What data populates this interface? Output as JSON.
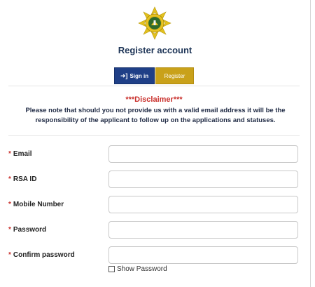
{
  "header": {
    "logo_icon": "coat-of-arms-badge-icon",
    "title": "Register account"
  },
  "tabs": [
    {
      "label": "Sign in",
      "icon": "sign-in-arrow-icon",
      "color": "#1f3f87"
    },
    {
      "label": "Register",
      "color": "#c9a11a",
      "active": true
    }
  ],
  "disclaimer": {
    "title": "***Disclaimer***",
    "text": "Please note that should you not provide us with a valid email address it will be the responsibility of the applicant to follow up on the applications and statuses."
  },
  "form": {
    "required_marker": "*",
    "fields": [
      {
        "label": "Email",
        "value": ""
      },
      {
        "label": "RSA ID",
        "value": ""
      },
      {
        "label": "Mobile Number",
        "value": ""
      },
      {
        "label": "Password",
        "value": ""
      },
      {
        "label": "Confirm password",
        "value": ""
      }
    ],
    "show_password_label": "Show Password",
    "show_password_checked": false
  },
  "colors": {
    "navy": "#1e3557",
    "red": "#c9302c",
    "gold": "#c9a11a"
  }
}
